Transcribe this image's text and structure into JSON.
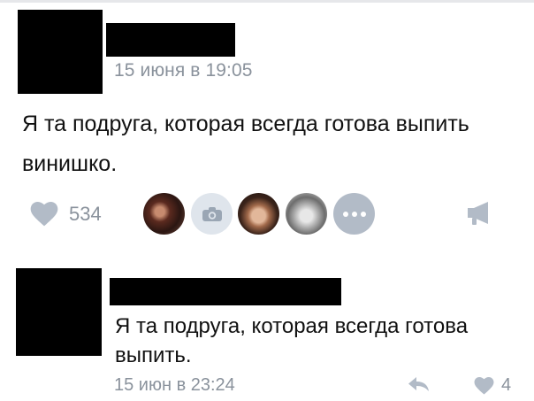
{
  "post": {
    "time": "15 июня в 19:05",
    "text": "Я та подруга, которая всегда готова выпить винишко.",
    "likes_count": "534"
  },
  "comment": {
    "text": "Я та подруга, которая всегда готова выпить.",
    "time": "15 июн в 23:24",
    "likes_count": "4"
  },
  "colors": {
    "muted": "#8a929c",
    "icon_gray": "#b2bbc7"
  }
}
